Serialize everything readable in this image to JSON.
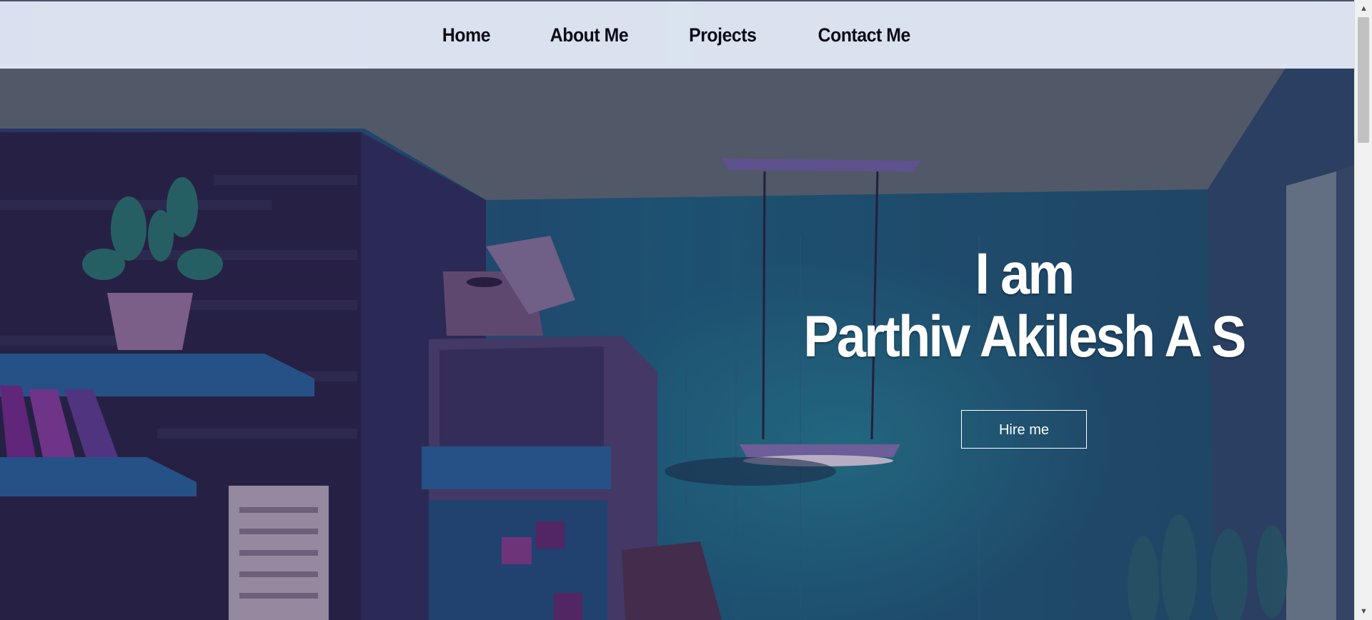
{
  "nav": {
    "items": [
      {
        "label": "Home"
      },
      {
        "label": "About Me"
      },
      {
        "label": "Projects"
      },
      {
        "label": "Contact Me"
      }
    ]
  },
  "hero": {
    "line1": "I am",
    "line2": "Parthiv Akilesh A S",
    "button_label": "Hire me"
  },
  "scrollbar": {
    "up_icon": "triangle-up",
    "down_icon": "triangle-down"
  },
  "colors": {
    "nav_bg": "#e8eefa",
    "nav_text": "#0c0c14",
    "hero_text": "#ffffff"
  }
}
